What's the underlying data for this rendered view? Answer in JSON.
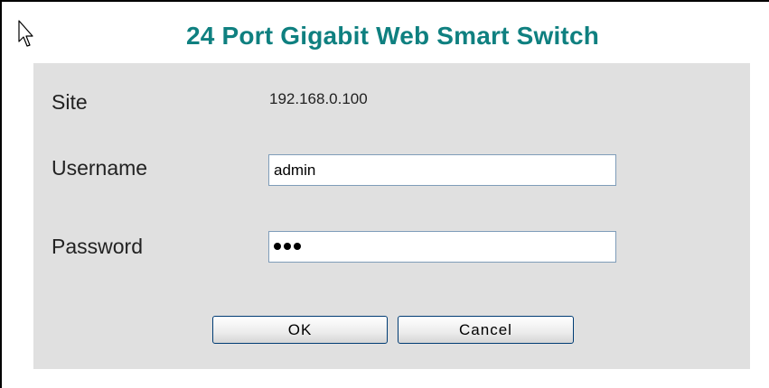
{
  "header": {
    "title": "24 Port Gigabit Web Smart Switch"
  },
  "login": {
    "site_label": "Site",
    "site_value": "192.168.0.100",
    "username_label": "Username",
    "username_value": "admin",
    "password_label": "Password",
    "password_masked_length": 3
  },
  "buttons": {
    "ok_label": "OK",
    "cancel_label": "Cancel"
  },
  "colors": {
    "title": "#0f8080",
    "panel_background": "#e0e0e0",
    "field_border": "#7f9db9",
    "button_border": "#003c74"
  },
  "icons": {
    "cursor": "mouse-pointer-icon"
  }
}
